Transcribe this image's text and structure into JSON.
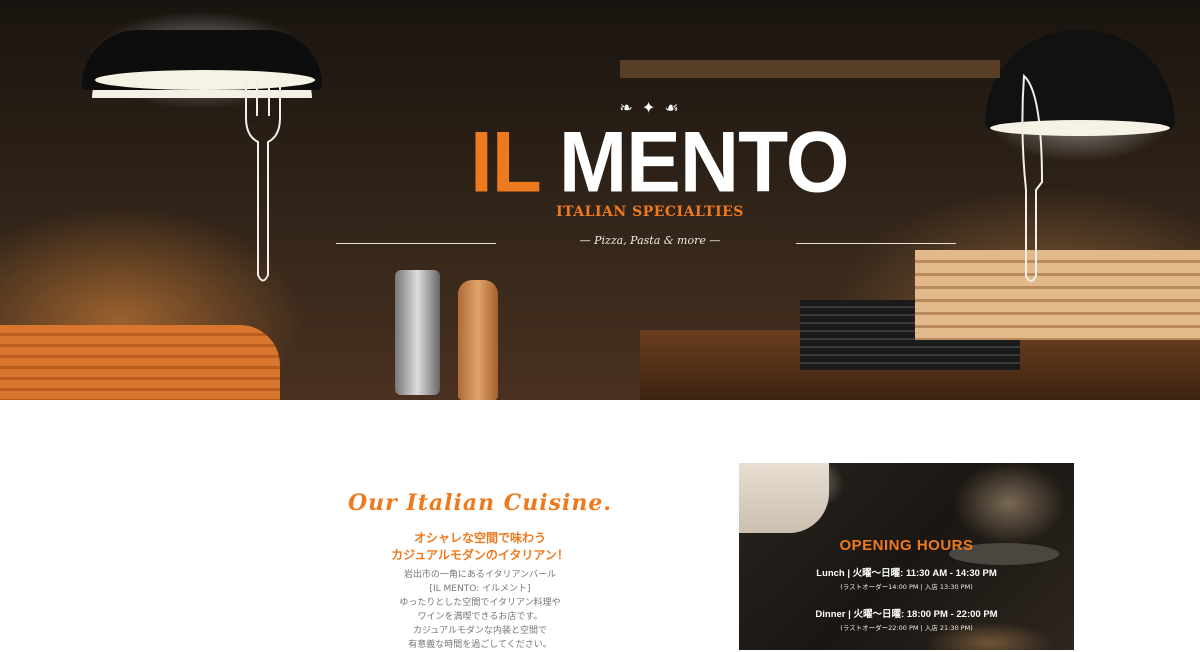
{
  "hero": {
    "ornament": "❧ ✦ ☙",
    "logo_il": "IL",
    "logo_mento": "MENTO",
    "tagline": "ITALIAN SPECIALTIES",
    "subtag": "— Pizza, Pasta & more —"
  },
  "cuisine": {
    "title": "Our Italian Cuisine.",
    "catch_line1": "オシャレな空間で味わう",
    "catch_line2": "カジュアルモダンのイタリアン！",
    "body": [
      "岩出市の一角にあるイタリアンバール",
      "[IL MENTO: イルメント]",
      "ゆったりとした空間でイタリアン料理や",
      "ワインを満喫できるお店です。",
      "カジュアルモダンな内装と空間で",
      "有意義な時間を過ごしてください。"
    ]
  },
  "hours": {
    "title": "OPENING HOURS",
    "lunch": "Lunch | 火曜〜日曜: 11:30 AM - 14:30 PM",
    "lunch_note": "(ラストオーダー14:00 PM | 入店 13:30 PM)",
    "dinner": "Dinner | 火曜〜日曜: 18:00 PM - 22:00 PM",
    "dinner_note": "(ラストオーダー22:00 PM | 入店 21:30 PM)"
  },
  "colors": {
    "accent": "#ee7a1f",
    "text_muted": "#777777",
    "white": "#ffffff"
  },
  "icons": {
    "fork": "fork-icon",
    "knife": "knife-icon"
  }
}
